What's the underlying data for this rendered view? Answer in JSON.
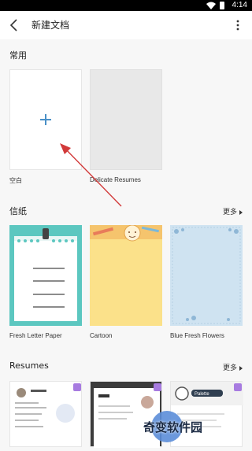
{
  "status_bar": {
    "time": "4:14",
    "wifi_icon": "wifi-icon",
    "battery_icon": "battery-icon"
  },
  "app_bar": {
    "title": "新建文档",
    "back_icon": "arrow-back-icon",
    "more_icon": "more-vert-icon"
  },
  "sections": {
    "common": {
      "title": "常用",
      "items": [
        {
          "label": "空白"
        },
        {
          "label": "Delicate Resumes"
        }
      ]
    },
    "letter": {
      "title": "信纸",
      "more": "更多",
      "items": [
        {
          "label": "Fresh Letter Paper"
        },
        {
          "label": "Cartoon"
        },
        {
          "label": "Blue Fresh Flowers"
        }
      ]
    },
    "resumes": {
      "title": "Resumes",
      "more": "更多",
      "items": [
        {
          "label": ""
        },
        {
          "label": ""
        },
        {
          "label": ""
        }
      ],
      "thumbnail_texts": [
        "Palette"
      ]
    }
  },
  "watermark": {
    "text": "奇变软件园"
  },
  "colors": {
    "accent": "#4a90c7",
    "teal": "#5cc7c0",
    "cartoon_bg": "#fbe18a",
    "blue_bg": "#cfe3f1",
    "arrow": "#d23a3a"
  }
}
